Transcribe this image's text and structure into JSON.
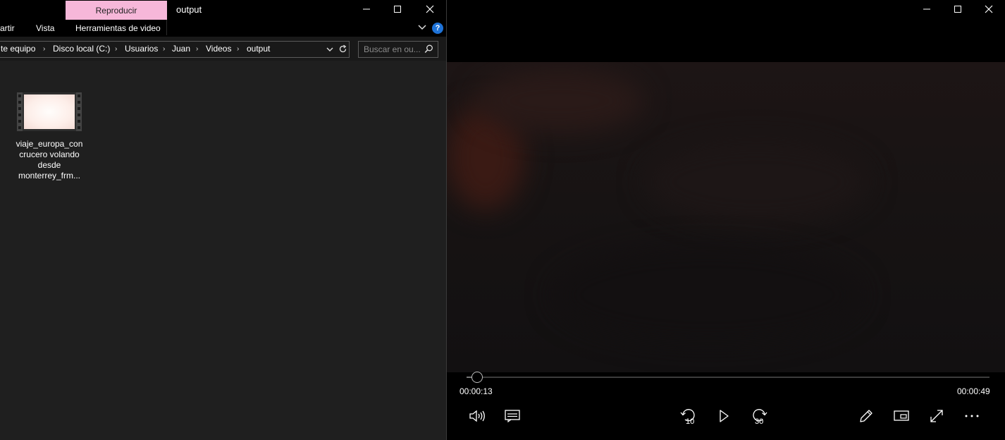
{
  "explorer": {
    "window_title": "output",
    "contextual_tab": "Reproducir",
    "ribbon_tabs": [
      "artir",
      "Vista",
      "Herramientas de video"
    ],
    "help_label": "?",
    "address": {
      "crumbs": [
        "te equipo",
        "Disco local (C:)",
        "Usuarios",
        "Juan",
        "Videos",
        "output"
      ],
      "separator": "›"
    },
    "search": {
      "placeholder": "Buscar en ou..."
    },
    "files": [
      {
        "name_lines": [
          "viaje_europa_con",
          "crucero volando",
          "desde",
          "monterrey_frm..."
        ],
        "icon": "video-file-icon"
      }
    ]
  },
  "player": {
    "current_time": "00:00:13",
    "total_time": "00:00:49",
    "progress": 0.02,
    "skip_back_label": "10",
    "skip_forward_label": "30",
    "controls": [
      "volume-icon",
      "subtitles-icon",
      "skip-back-10-icon",
      "play-icon",
      "skip-forward-30-icon",
      "edit-icon",
      "mini-view-icon",
      "fullscreen-icon",
      "more-icon"
    ]
  },
  "colors": {
    "contextual_tab": "#f6b7d9",
    "help": "#1e73d8",
    "explorer_bg": "#1f1f1f",
    "player_bg": "#000000"
  }
}
